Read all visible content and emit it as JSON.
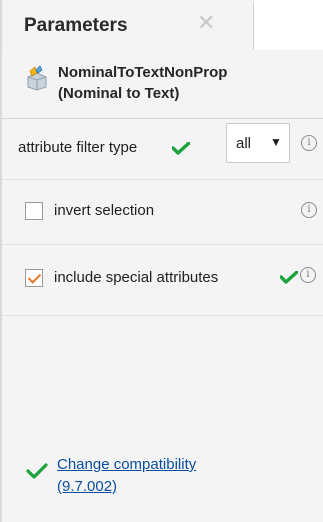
{
  "tab": {
    "title": "Parameters",
    "close_glyph": "✕"
  },
  "operator": {
    "icon": "nominal-to-text-icon",
    "name_line1": "NominalToTextNonProp",
    "name_line2": "(Nominal to Text)"
  },
  "parameters": [
    {
      "label": "attribute filter type",
      "type": "select",
      "value": "all",
      "arrow": "▼",
      "modified": true,
      "info": "i"
    },
    {
      "label": "invert selection",
      "type": "checkbox",
      "checked": false,
      "modified": false,
      "info": "i"
    },
    {
      "label": "include special attributes",
      "type": "checkbox",
      "checked": true,
      "modified": true,
      "info": "i"
    }
  ],
  "compatibility": {
    "line1": "Change compatibility",
    "line2": "(9.7.002)"
  },
  "colors": {
    "green_check": "#1aa33c",
    "checkbox_check": "#e8762c",
    "link": "#0b4ea2"
  }
}
